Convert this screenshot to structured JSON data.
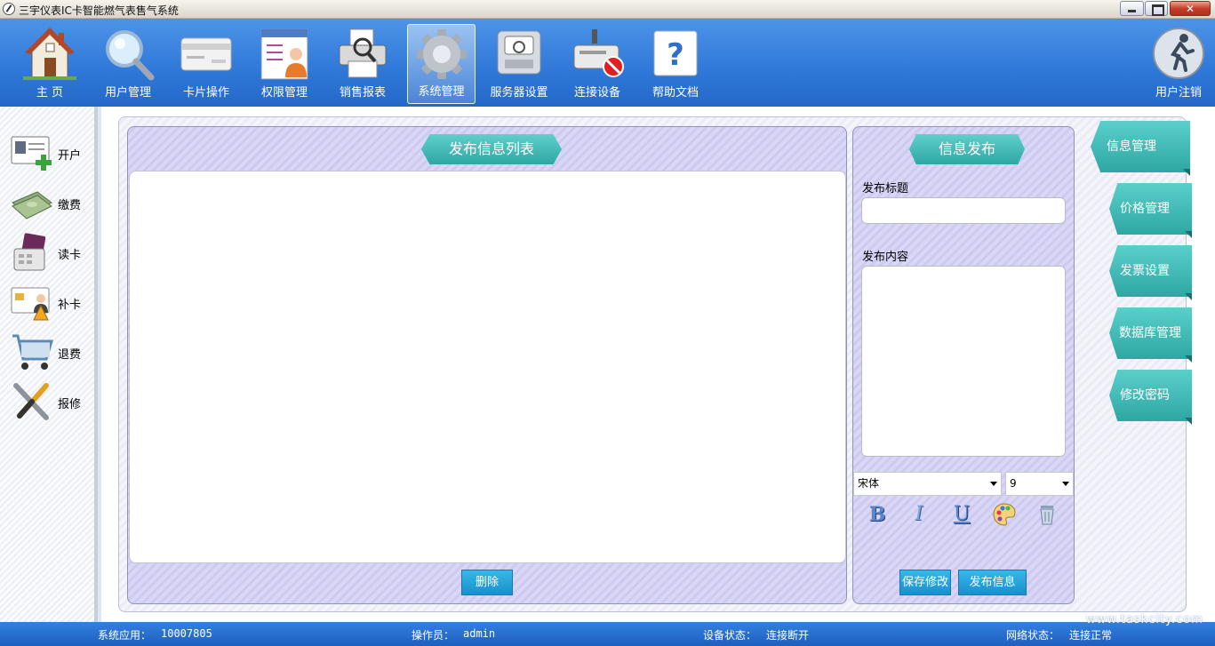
{
  "window": {
    "title": "三宇仪表IC卡智能燃气表售气系统"
  },
  "toolbar": {
    "items": [
      {
        "label": "主 页",
        "icon": "home-icon"
      },
      {
        "label": "用户管理",
        "icon": "magnifier-icon"
      },
      {
        "label": "卡片操作",
        "icon": "card-icon"
      },
      {
        "label": "权限管理",
        "icon": "user-profile-icon"
      },
      {
        "label": "销售报表",
        "icon": "printer-icon"
      },
      {
        "label": "系统管理",
        "icon": "gear-icon",
        "active": true
      },
      {
        "label": "服务器设置",
        "icon": "server-icon"
      },
      {
        "label": "连接设备",
        "icon": "device-icon"
      },
      {
        "label": "帮助文档",
        "icon": "help-icon"
      }
    ],
    "logout_label": "用户注销"
  },
  "sidebar": {
    "items": [
      {
        "label": "开户",
        "icon": "id-card-add-icon"
      },
      {
        "label": "缴费",
        "icon": "money-icon"
      },
      {
        "label": "读卡",
        "icon": "card-reader-icon"
      },
      {
        "label": "补卡",
        "icon": "card-warning-icon"
      },
      {
        "label": "退费",
        "icon": "cart-icon"
      },
      {
        "label": "报修",
        "icon": "tools-icon"
      }
    ]
  },
  "list_panel": {
    "title": "发布信息列表",
    "delete_label": "删除"
  },
  "publish_panel": {
    "title": "信息发布",
    "title_label": "发布标题",
    "title_value": "",
    "content_label": "发布内容",
    "content_value": "",
    "font_value": "宋体",
    "size_value": "9",
    "format_buttons": [
      "B",
      "I",
      "U"
    ],
    "save_label": "保存修改",
    "publish_label": "发布信息"
  },
  "right_tabs": [
    "信息管理",
    "价格管理",
    "发票设置",
    "数据库管理",
    "修改密码"
  ],
  "status": {
    "app_label": "系统应用：",
    "app_value": "10007805",
    "operator_label": "操作员：",
    "operator_value": "admin",
    "device_label": "设备状态：",
    "device_value": "连接断开",
    "network_label": "网络状态：",
    "network_value": "连接正常"
  },
  "watermark": "www.taskcity.com",
  "colors": {
    "toolbar": "#2f78d8",
    "teal_ribbon": "#3cb5b1",
    "panel": "#d5d3f3",
    "button": "#1a8fcd"
  }
}
